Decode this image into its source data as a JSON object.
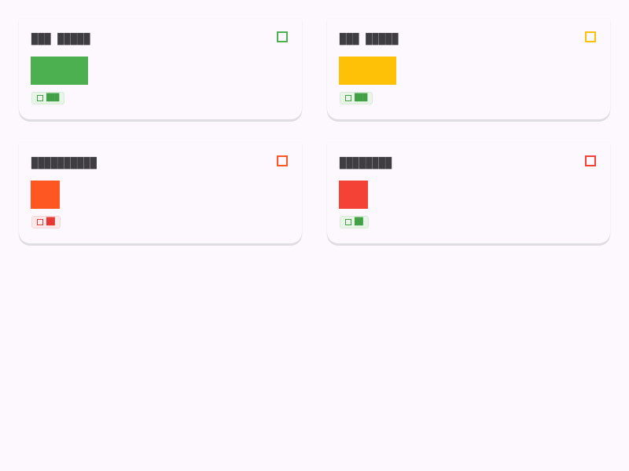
{
  "cards": [
    {
      "title": "███ █████",
      "accent": "#4caf50",
      "status": "success",
      "badge": {
        "text": "███",
        "fg": "#43a047",
        "bg": "#eaf5ea",
        "border": "#d6ead6",
        "icon": "check-icon"
      },
      "level": 0.2
    },
    {
      "title": "███ █████",
      "accent": "#ffc107",
      "status": "warning",
      "badge": {
        "text": "███",
        "fg": "#43a047",
        "bg": "#eaf5ea",
        "border": "#d6ead6",
        "icon": "check-icon"
      },
      "level": 0.2
    },
    {
      "title": "██████████",
      "accent": "#ff5722",
      "status": "alert",
      "badge": {
        "text": "██",
        "fg": "#e53935",
        "bg": "#fdebec",
        "border": "#f7d4d6",
        "icon": "alert-icon"
      },
      "level": 0.1
    },
    {
      "title": "████████",
      "accent": "#f44336",
      "status": "critical",
      "badge": {
        "text": "██",
        "fg": "#43a047",
        "bg": "#eaf5ea",
        "border": "#d6ead6",
        "icon": "check-icon"
      },
      "level": 0.1
    }
  ]
}
